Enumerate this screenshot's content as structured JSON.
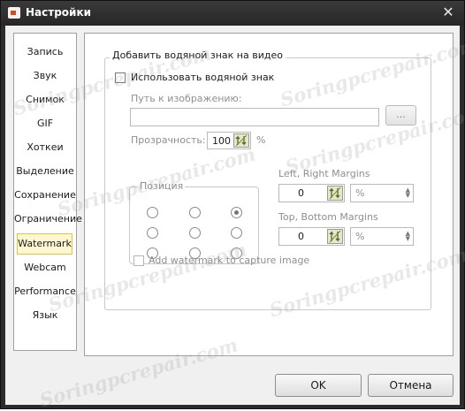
{
  "window": {
    "title": "Настройки",
    "close_glyph": "✕"
  },
  "sidebar": {
    "items": [
      {
        "label": "Запись"
      },
      {
        "label": "Звук"
      },
      {
        "label": "Снимок"
      },
      {
        "label": "GIF"
      },
      {
        "label": "Хоткеи"
      },
      {
        "label": "Выделение"
      },
      {
        "label": "Сохранение"
      },
      {
        "label": "Ограничение"
      },
      {
        "label": "Watermark",
        "selected": true
      },
      {
        "label": "Webcam"
      },
      {
        "label": "Performance"
      },
      {
        "label": "Язык"
      }
    ]
  },
  "watermark_settings": {
    "group_title": "Добавить водяной знак на видео",
    "use_watermark_label": "Использовать водяной знак",
    "use_watermark_checked": false,
    "image_path_label": "Путь к изображению:",
    "image_path_value": "",
    "browse_label": "...",
    "transparency_label": "Прозрачность:",
    "transparency_value": "100",
    "transparency_unit": "%",
    "position_label": "Позиция",
    "position_selected": "top-right",
    "lr_margins_label": "Left, Right Margins",
    "lr_margins_value": "0",
    "lr_unit": "%",
    "tb_margins_label": "Top, Bottom Margins",
    "tb_margins_value": "0",
    "tb_unit": "%",
    "capture_image_label": "Add watermark to capture image",
    "capture_image_checked": false
  },
  "footer": {
    "ok_label": "OK",
    "cancel_label": "Отмена"
  },
  "overlay_watermark": {
    "text": "Soringpcrepair.com"
  },
  "colors": {
    "titlebar": "#2c2c2c",
    "selected_bg": "#fff7d1",
    "selected_border": "#e2c34a"
  }
}
